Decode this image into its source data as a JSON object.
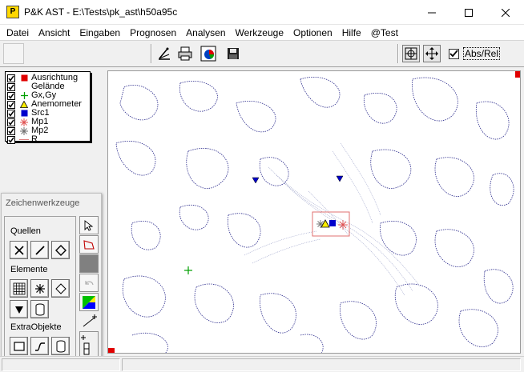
{
  "window": {
    "title": "P&K AST - E:\\Tests\\pk_ast\\h50a95c",
    "icon_glyph": "P"
  },
  "menu": [
    "Datei",
    "Ansicht",
    "Eingaben",
    "Prognosen",
    "Analysen",
    "Werkzeuge",
    "Optionen",
    "Hilfe",
    "@Test"
  ],
  "toolbar": {
    "checkbox_label": "Abs/Rel",
    "checkbox_checked": true
  },
  "legend": {
    "items": [
      {
        "label": "Ausrichtung",
        "symbol": "red-square-icon",
        "checked": true
      },
      {
        "label": "Gelände",
        "symbol": "none",
        "checked": true
      },
      {
        "label": "Gx,Gy",
        "symbol": "green-plus-icon",
        "checked": true
      },
      {
        "label": "Anemometer",
        "symbol": "yellow-triangle-icon",
        "checked": true
      },
      {
        "label": "Src1",
        "symbol": "blue-square-icon",
        "checked": true
      },
      {
        "label": "Mp1",
        "symbol": "red-asterisk-icon",
        "checked": true
      },
      {
        "label": "Mp2",
        "symbol": "gray-asterisk-icon",
        "checked": true
      },
      {
        "label": "R",
        "symbol": "pink-line-icon",
        "checked": true
      }
    ]
  },
  "palette": {
    "title": "Zeichenwerkzeuge",
    "sections": {
      "quellen": "Quellen",
      "elemente": "Elemente",
      "extra": "ExtraObjekte"
    }
  },
  "colors": {
    "contour": "#2b2b8c",
    "contour_light": "#9aa0c8",
    "marker_red": "#e00000",
    "marker_blue": "#0000cc",
    "marker_yellow": "#ffee00",
    "marker_green": "#00a000",
    "selection_box": "#e07070"
  }
}
